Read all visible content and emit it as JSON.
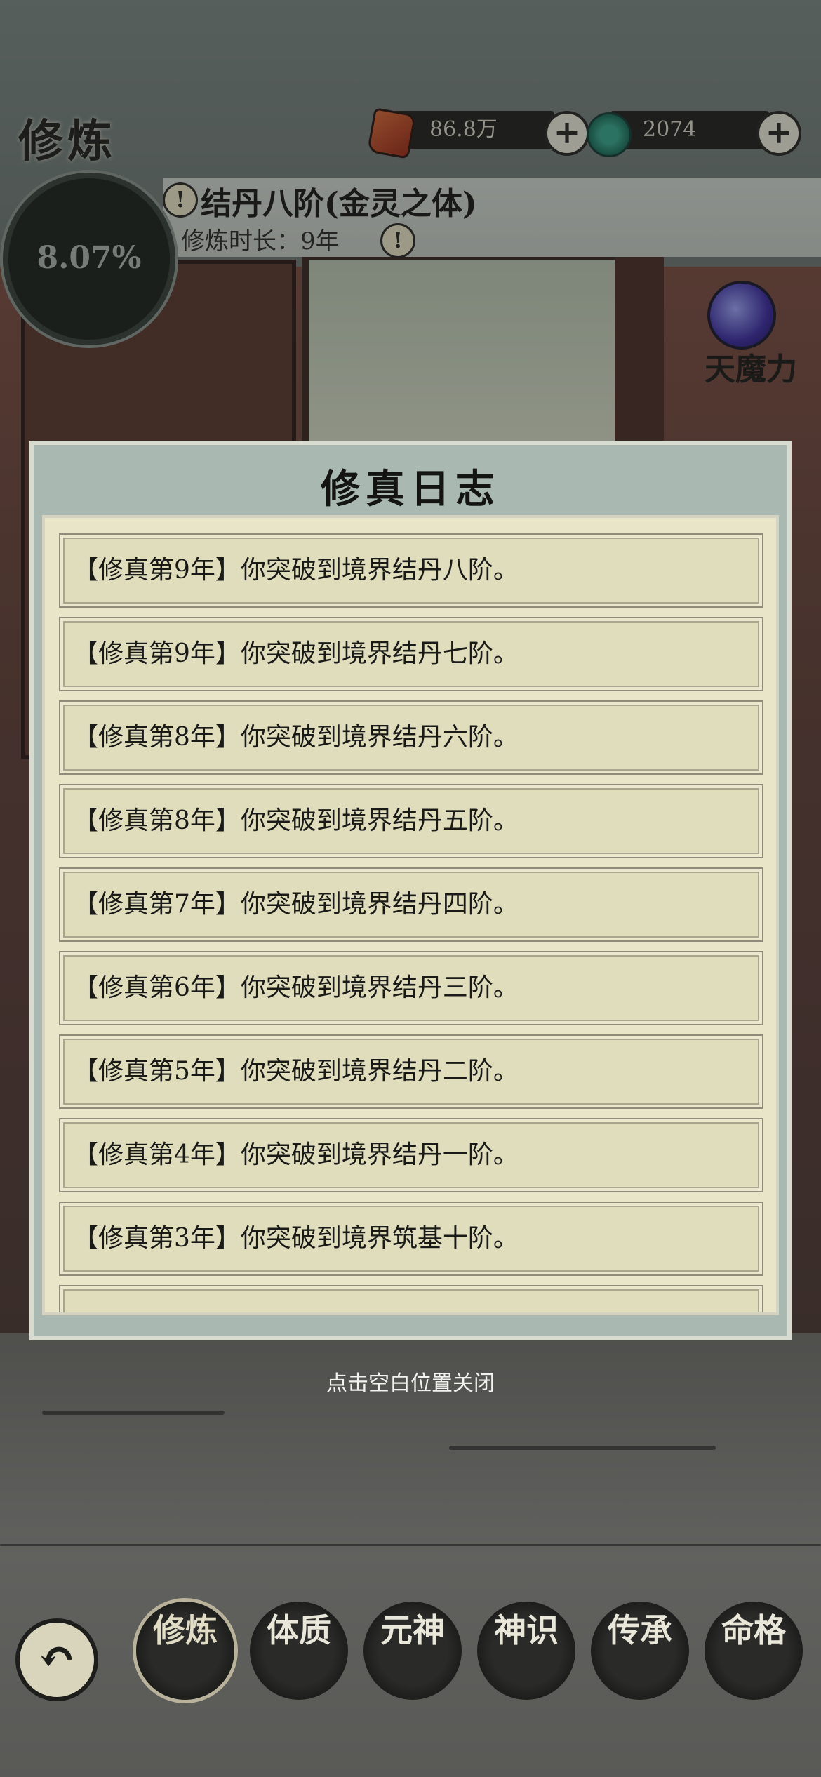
{
  "header": {
    "title": "修炼",
    "spirit_stones": "86.8万",
    "jade_count": "2074"
  },
  "status": {
    "progress": "8.07%",
    "realm": "结丹八阶(金灵之体)",
    "duration": "修炼时长：9年",
    "side_label": "天魔力"
  },
  "modal": {
    "title": "修真日志",
    "entries": [
      "【修真第9年】你突破到境界结丹八阶。",
      "【修真第9年】你突破到境界结丹七阶。",
      "【修真第8年】你突破到境界结丹六阶。",
      "【修真第8年】你突破到境界结丹五阶。",
      "【修真第7年】你突破到境界结丹四阶。",
      "【修真第6年】你突破到境界结丹三阶。",
      "【修真第5年】你突破到境界结丹二阶。",
      "【修真第4年】你突破到境界结丹一阶。",
      "【修真第3年】你突破到境界筑基十阶。"
    ],
    "close_hint": "点击空白位置关闭"
  },
  "nav": {
    "back_icon": "↶",
    "items": [
      "修炼",
      "体质",
      "元神",
      "神识",
      "传承",
      "命格"
    ]
  },
  "colors": {
    "modal_frame": "#a9b8b0",
    "panel": "#e9e5c9",
    "row": "#e0ddbd"
  }
}
